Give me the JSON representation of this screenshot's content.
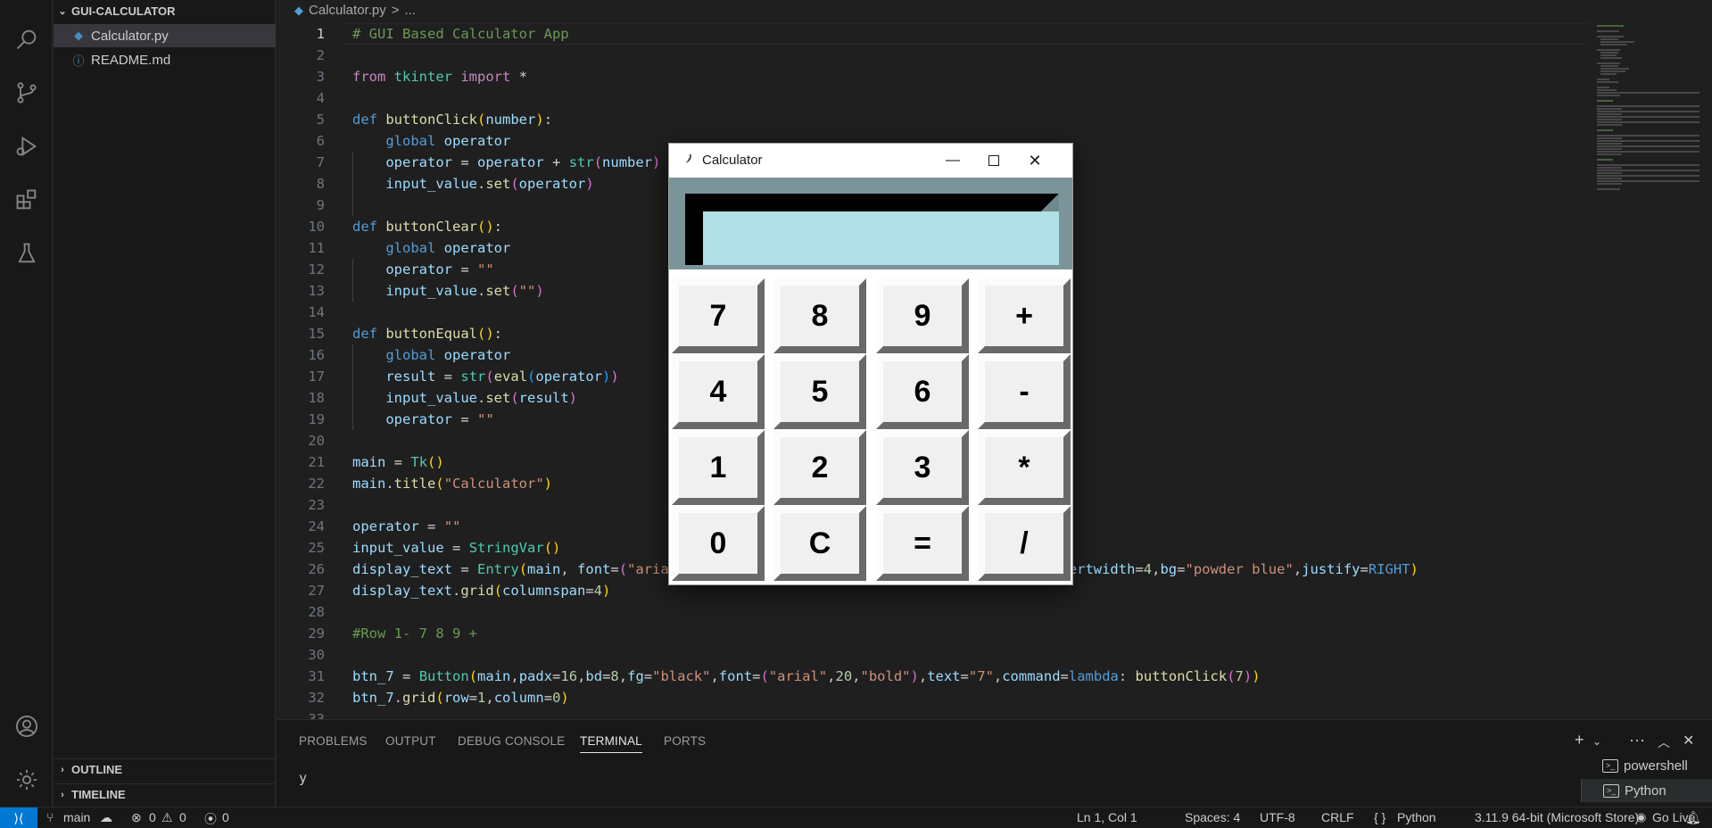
{
  "sidebar": {
    "project": "GUI-CALCULATOR",
    "files": [
      {
        "name": "Calculator.py",
        "icon": "python-file-icon"
      },
      {
        "name": "README.md",
        "icon": "info-icon"
      }
    ],
    "outline": "OUTLINE",
    "timeline": "TIMELINE"
  },
  "breadcrumb": {
    "file": "Calculator.py",
    "sep": ">",
    "rest": "..."
  },
  "editor": {
    "cursor_line": 1,
    "last_line": 33
  },
  "panel": {
    "tabs": [
      "PROBLEMS",
      "OUTPUT",
      "DEBUG CONSOLE",
      "TERMINAL",
      "PORTS"
    ],
    "active_tab": "TERMINAL",
    "terminal_text": "y",
    "terminals": [
      "powershell",
      "Python"
    ]
  },
  "status": {
    "branch": "main",
    "errors": "0",
    "warnings": "0",
    "ports": "0",
    "position": "Ln 1, Col 1",
    "spaces": "Spaces: 4",
    "encoding": "UTF-8",
    "eol": "CRLF",
    "language": "Python",
    "interpreter": "3.11.9 64-bit (Microsoft Store)",
    "golive": "Go Live"
  },
  "calculator": {
    "title": "Calculator",
    "display_value": "",
    "display_color": "#b0e0e6",
    "keys": [
      "7",
      "8",
      "9",
      "+",
      "4",
      "5",
      "6",
      "-",
      "1",
      "2",
      "3",
      "*",
      "0",
      "C",
      "=",
      "/"
    ]
  },
  "colors": {
    "accent": "#0078d4",
    "editor_bg": "#1f1f1f",
    "sidebar_bg": "#181818"
  }
}
